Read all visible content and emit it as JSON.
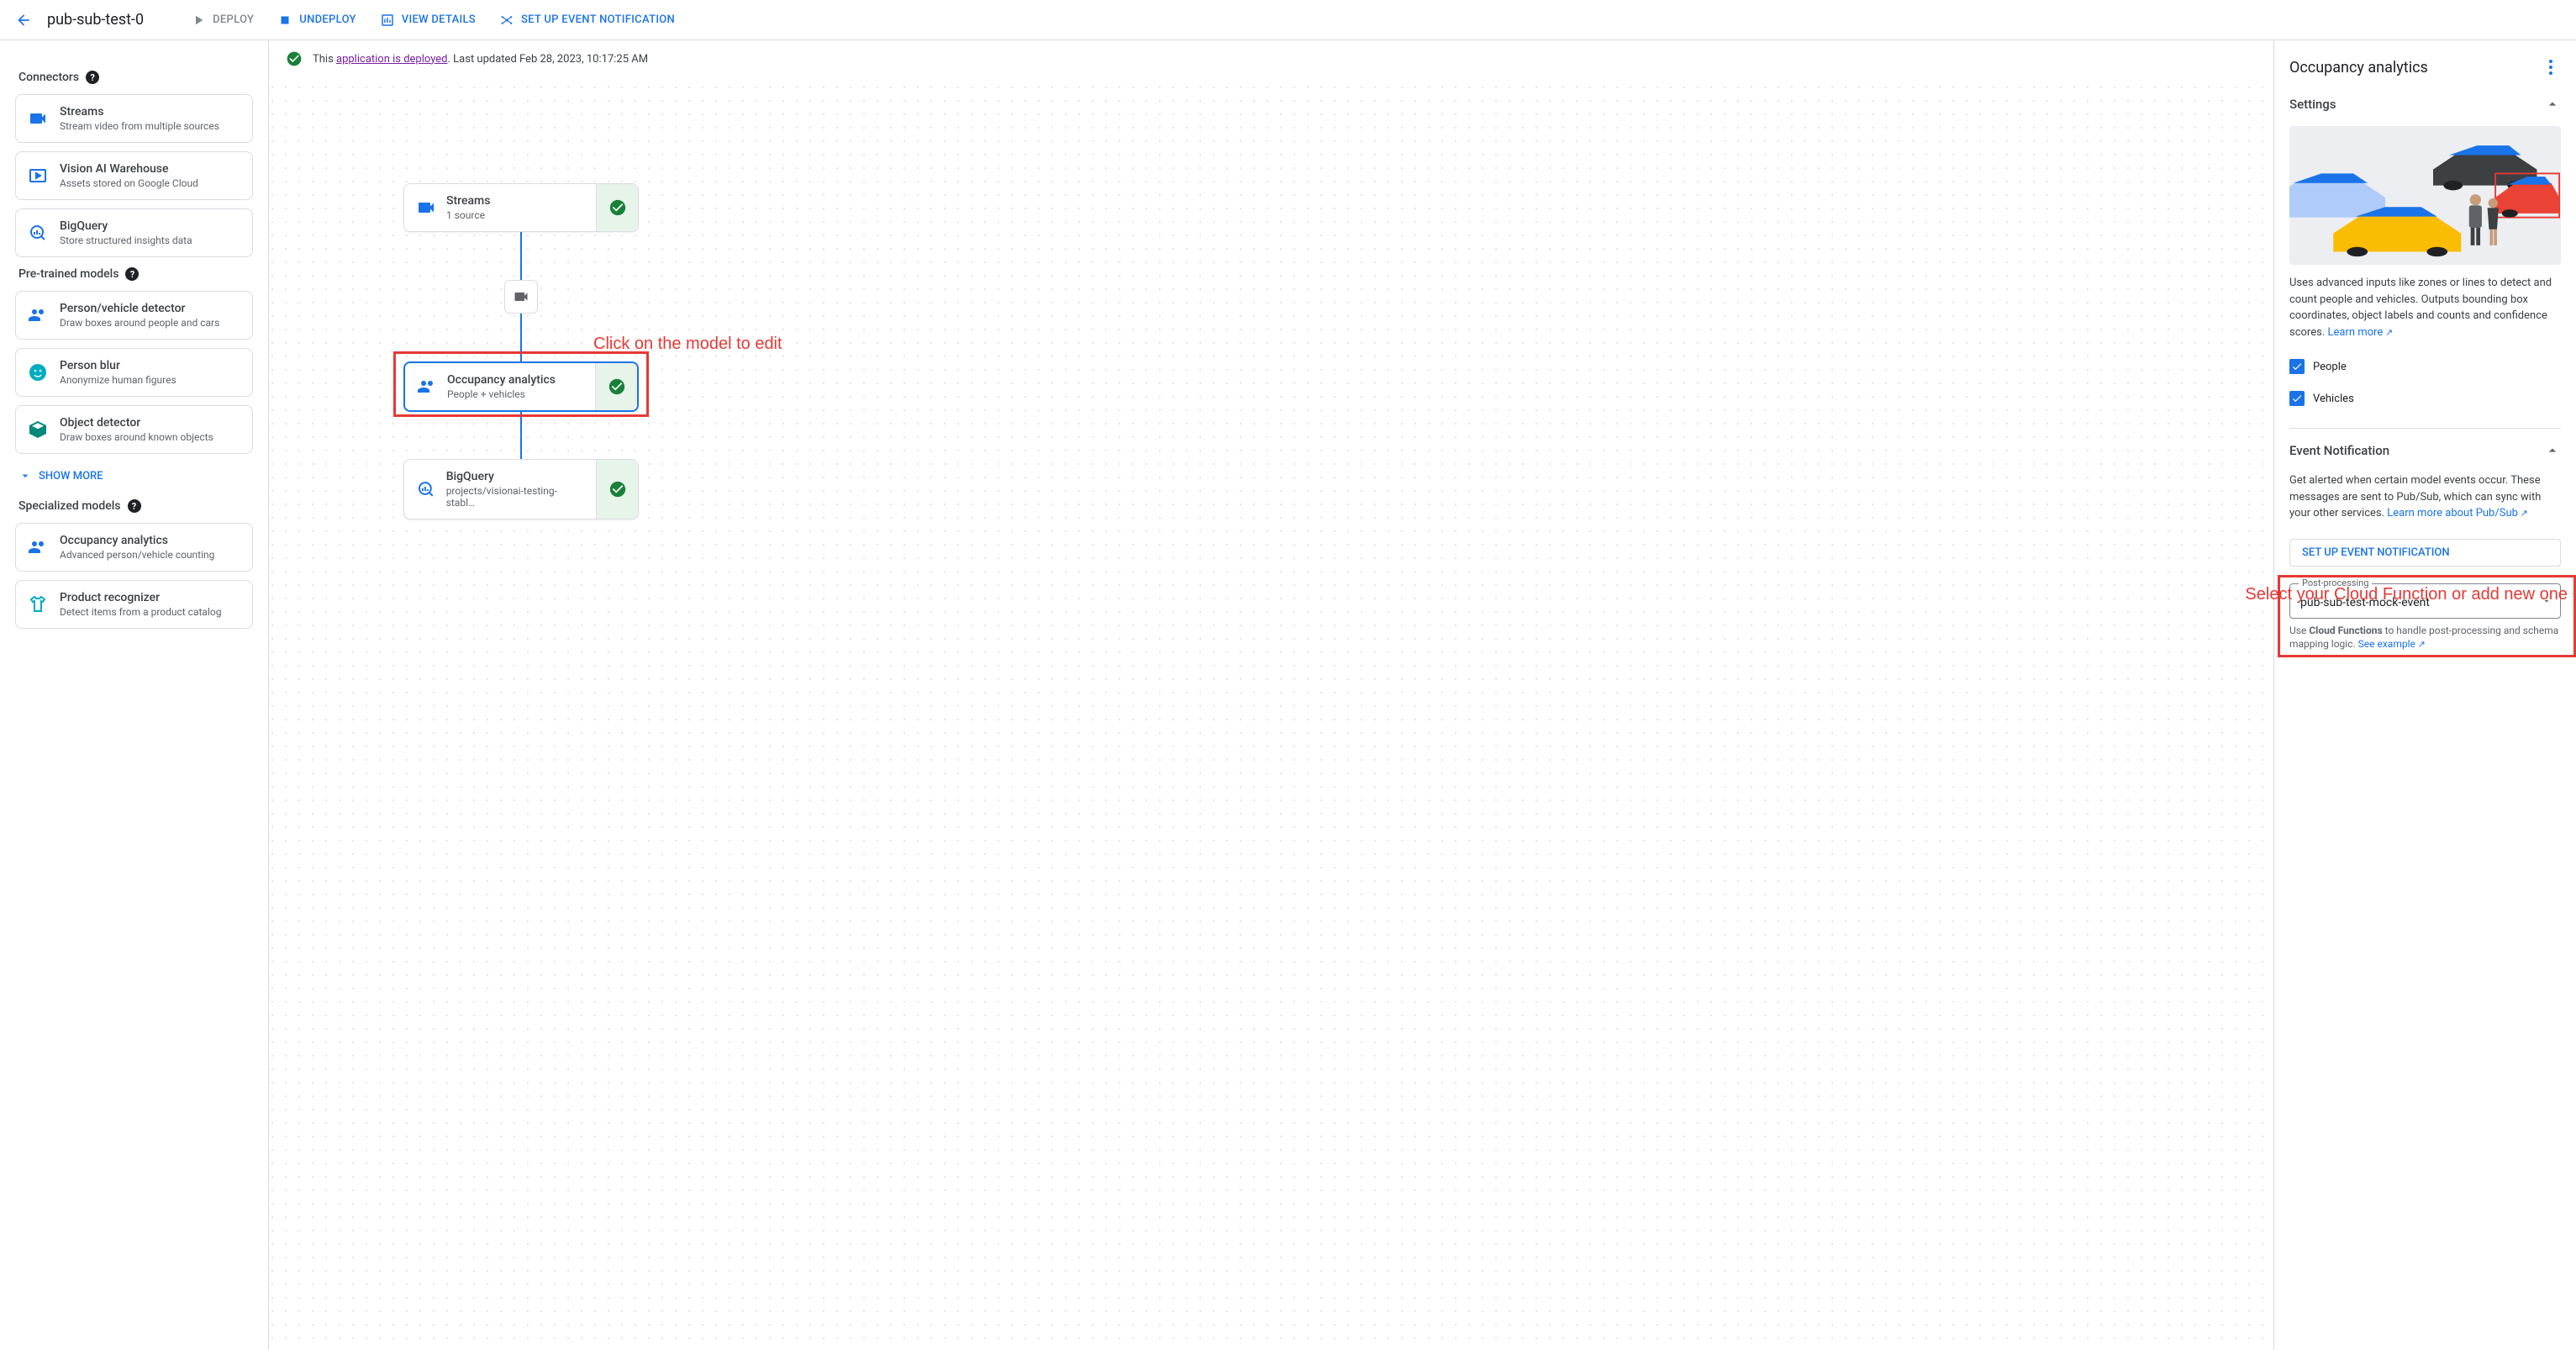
{
  "header": {
    "title": "pub-sub-test-0",
    "deploy": "DEPLOY",
    "undeploy": "UNDEPLOY",
    "view_details": "VIEW DETAILS",
    "setup_event": "SET UP EVENT NOTIFICATION"
  },
  "status": {
    "prefix": "This ",
    "link": "application is deployed",
    "suffix": ". Last updated Feb 28, 2023, 10:17:25 AM"
  },
  "sidebar": {
    "sections": {
      "connectors": "Connectors",
      "pretrained": "Pre-trained models",
      "specialized": "Specialized models"
    },
    "show_more": "SHOW MORE",
    "items": {
      "streams": {
        "title": "Streams",
        "sub": "Stream video from multiple sources"
      },
      "warehouse": {
        "title": "Vision AI Warehouse",
        "sub": "Assets stored on Google Cloud"
      },
      "bigquery": {
        "title": "BigQuery",
        "sub": "Store structured insights data"
      },
      "pvd": {
        "title": "Person/vehicle detector",
        "sub": "Draw boxes around people and cars"
      },
      "blur": {
        "title": "Person blur",
        "sub": "Anonymize human figures"
      },
      "obj": {
        "title": "Object detector",
        "sub": "Draw boxes around known objects"
      },
      "occ": {
        "title": "Occupancy analytics",
        "sub": "Advanced person/vehicle counting"
      },
      "prod": {
        "title": "Product recognizer",
        "sub": "Detect items from a product catalog"
      }
    }
  },
  "canvas": {
    "nodes": {
      "streams": {
        "title": "Streams",
        "sub": "1 source"
      },
      "occupancy": {
        "title": "Occupancy analytics",
        "sub": "People + vehicles"
      },
      "bigquery": {
        "title": "BigQuery",
        "sub": "projects/visionai-testing-stabl…"
      }
    },
    "annotations": {
      "model_edit": "Click on the model to edit",
      "cloud_fn": "Select your Cloud Function or add new one"
    }
  },
  "right": {
    "title": "Occupancy analytics",
    "settings_label": "Settings",
    "desc": "Uses advanced inputs like zones or lines to detect and count people and vehicles. Outputs bounding box coordinates, object labels and counts and confidence scores. ",
    "learn_more": "Learn more",
    "checks": {
      "people": "People",
      "vehicles": "Vehicles"
    },
    "event_label": "Event Notification",
    "event_desc": "Get alerted when certain model events occur. These messages are sent to Pub/Sub, which can sync with your other services. ",
    "event_link": "Learn more about Pub/Sub",
    "setup_btn": "SET UP EVENT NOTIFICATION",
    "select": {
      "label": "Post-processing",
      "value": "pub-sub-test-mock-event"
    },
    "helper_pre": "Use ",
    "helper_bold": "Cloud Functions",
    "helper_post": " to handle post-processing and schema mapping logic. ",
    "helper_link": "See example"
  }
}
